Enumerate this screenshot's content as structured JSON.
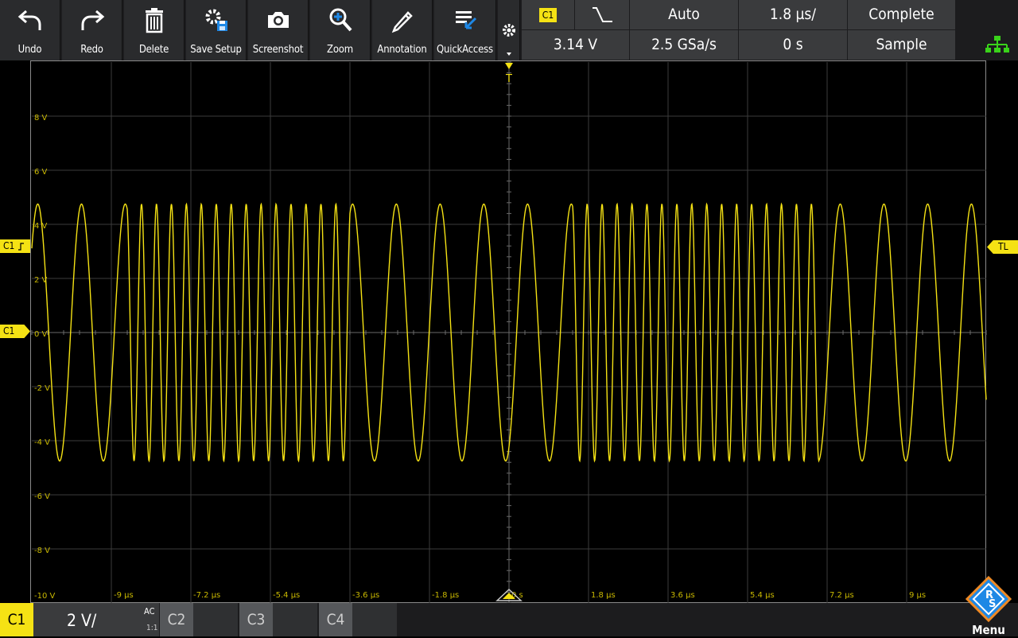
{
  "toolbar": {
    "buttons": [
      {
        "label": "Undo",
        "icon": "undo-icon"
      },
      {
        "label": "Redo",
        "icon": "redo-icon"
      },
      {
        "label": "Delete",
        "icon": "trash-icon"
      },
      {
        "label": "Save Setup",
        "icon": "save-setup-icon"
      },
      {
        "label": "Screenshot",
        "icon": "camera-icon"
      },
      {
        "label": "Zoom",
        "icon": "zoom-icon"
      },
      {
        "label": "Annotation",
        "icon": "pencil-icon"
      },
      {
        "label": "QuickAccess",
        "icon": "quick-access-icon"
      }
    ]
  },
  "status": {
    "trigger_source": "C1",
    "trigger_level": "3.14 V",
    "trigger_mode": "Auto",
    "sample_rate": "2.5 GSa/s",
    "time_scale": "1.8 µs/",
    "time_position": "0 s",
    "acq_status": "Complete",
    "acq_mode": "Sample"
  },
  "screen": {
    "y_labels": [
      "8 V",
      "6 V",
      "4 V",
      "2 V",
      "0 V",
      "-2 V",
      "-4 V",
      "-6 V",
      "-8 V",
      "-10 V"
    ],
    "x_labels": [
      "-9 µs",
      "-7.2 µs",
      "-5.4 µs",
      "-3.6 µs",
      "-1.8 µs",
      "0 s",
      "1.8 µs",
      "3.6 µs",
      "5.4 µs",
      "7.2 µs",
      "9 µs"
    ],
    "trigger_marker": "T",
    "trigger_level_marker": "TL",
    "ch1_trig_marker": "C1",
    "ch1_offset_marker": "C1",
    "trace_color": "#f5e214"
  },
  "bottom": {
    "ch1": {
      "name": "C1",
      "scale": "2 V/",
      "coupling": "AC",
      "probe": "1:1"
    },
    "ch2": {
      "name": "C2"
    },
    "ch3": {
      "name": "C3"
    },
    "ch4": {
      "name": "C4"
    },
    "menu_label": "Menu"
  }
}
